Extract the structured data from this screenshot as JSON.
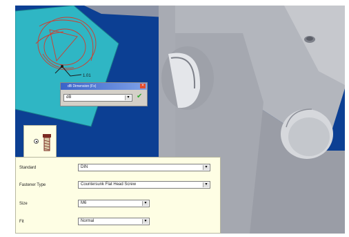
{
  "viewport": {
    "background": "#0c3f93",
    "sketch_dimension": "1.01"
  },
  "dimension_dialog": {
    "title": "dB Dimension (Fx)",
    "value": "dB",
    "ok_icon": "checkmark-icon",
    "close_icon": "close-icon"
  },
  "fastener_panel": {
    "tab_icon": "screw-icon",
    "radio_selected": true,
    "rows": [
      {
        "label": "Standard",
        "value": "DIN"
      },
      {
        "label": "Fastener Type",
        "value": "Countersunk Flat Head Screw"
      },
      {
        "label": "Size",
        "value": "M6"
      },
      {
        "label": "Fit",
        "value": "Normal"
      }
    ]
  }
}
